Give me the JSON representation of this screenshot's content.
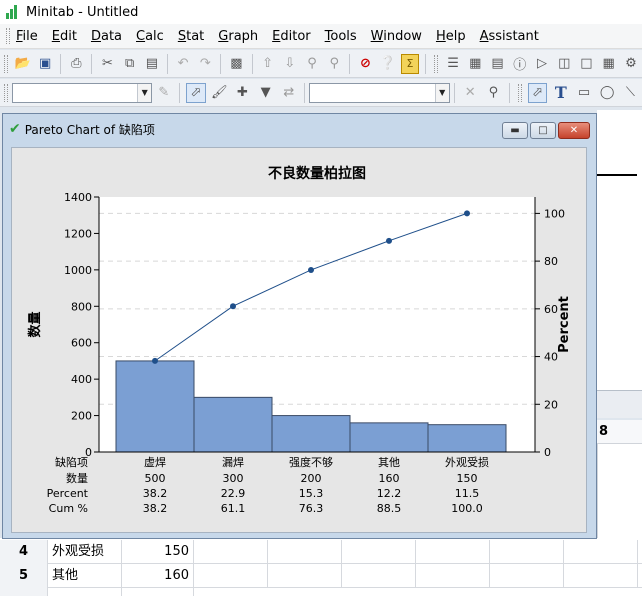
{
  "app": {
    "title": "Minitab - Untitled"
  },
  "menu": [
    "File",
    "Edit",
    "Data",
    "Calc",
    "Stat",
    "Graph",
    "Editor",
    "Tools",
    "Window",
    "Help",
    "Assistant"
  ],
  "graph_window": {
    "title": "Pareto Chart of 缺陷项"
  },
  "chart_data": {
    "type": "bar",
    "title": "不良数量柏拉图",
    "ylabel": "数量",
    "ylabel_right": "Percent",
    "ylim": [
      0,
      1400
    ],
    "y_ticks": [
      0,
      200,
      400,
      600,
      800,
      1000,
      1200,
      1400
    ],
    "ylim_right": [
      0,
      100
    ],
    "y_ticks_right": [
      0,
      20,
      40,
      60,
      80,
      100
    ],
    "categories": [
      "虚焊",
      "漏焊",
      "强度不够",
      "其他",
      "外观受损"
    ],
    "values": [
      500,
      300,
      200,
      160,
      150
    ],
    "percent": [
      "38.2",
      "22.9",
      "15.3",
      "12.2",
      "11.5"
    ],
    "cum_percent": [
      "38.2",
      "61.1",
      "76.3",
      "88.5",
      "100.0"
    ],
    "cum_percent_values": [
      38.2,
      61.1,
      76.3,
      88.5,
      100.0
    ],
    "table_row_labels": [
      "缺陷项",
      "数量",
      "Percent",
      "Cum %"
    ],
    "bar_color": "#7b9fd3",
    "line_color": "#1f4f8a",
    "grid": true
  },
  "bg_sheet": {
    "col_header": "8",
    "rows": [
      {
        "num": "4",
        "c1": "外观受损",
        "c2": "150"
      },
      {
        "num": "5",
        "c1": "其他",
        "c2": "160"
      }
    ]
  }
}
